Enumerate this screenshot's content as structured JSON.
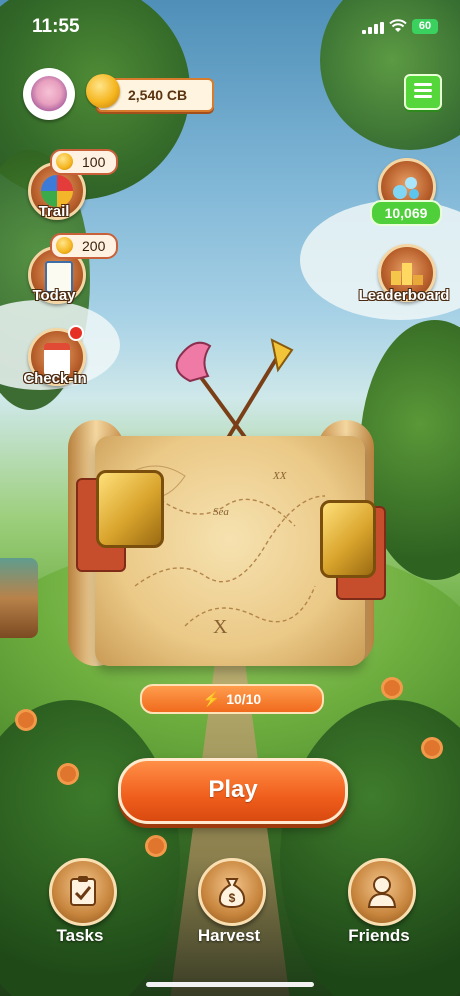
{
  "status_bar": {
    "time": "11:55",
    "battery": "60"
  },
  "header": {
    "balance": "2,540 CB",
    "menu_icon": "hamburger-menu-icon"
  },
  "side_left": [
    {
      "label": "Trail",
      "reward": "100",
      "icon": "trail-wheel-icon"
    },
    {
      "label": "Today",
      "reward": "200",
      "icon": "notepad-icon"
    },
    {
      "label": "Check-in",
      "icon": "calendar-icon",
      "has_notification": true
    }
  ],
  "side_right": {
    "score": {
      "value": "10,069",
      "icon": "bubbles-icon"
    },
    "leaderboard": {
      "label": "Leaderboard",
      "icon": "podium-icon"
    }
  },
  "map": {
    "sea_label": "Sea",
    "x_mark": "X",
    "xx_mark": "XX"
  },
  "energy": "10/10",
  "play_label": "Play",
  "bottom_nav": [
    {
      "label": "Tasks",
      "icon": "clipboard-check-icon"
    },
    {
      "label": "Harvest",
      "icon": "money-bag-icon"
    },
    {
      "label": "Friends",
      "icon": "user-icon"
    }
  ],
  "colors": {
    "accent_orange": "#f06a1d",
    "menu_green": "#55d63a",
    "score_green": "#4fcf3a"
  }
}
